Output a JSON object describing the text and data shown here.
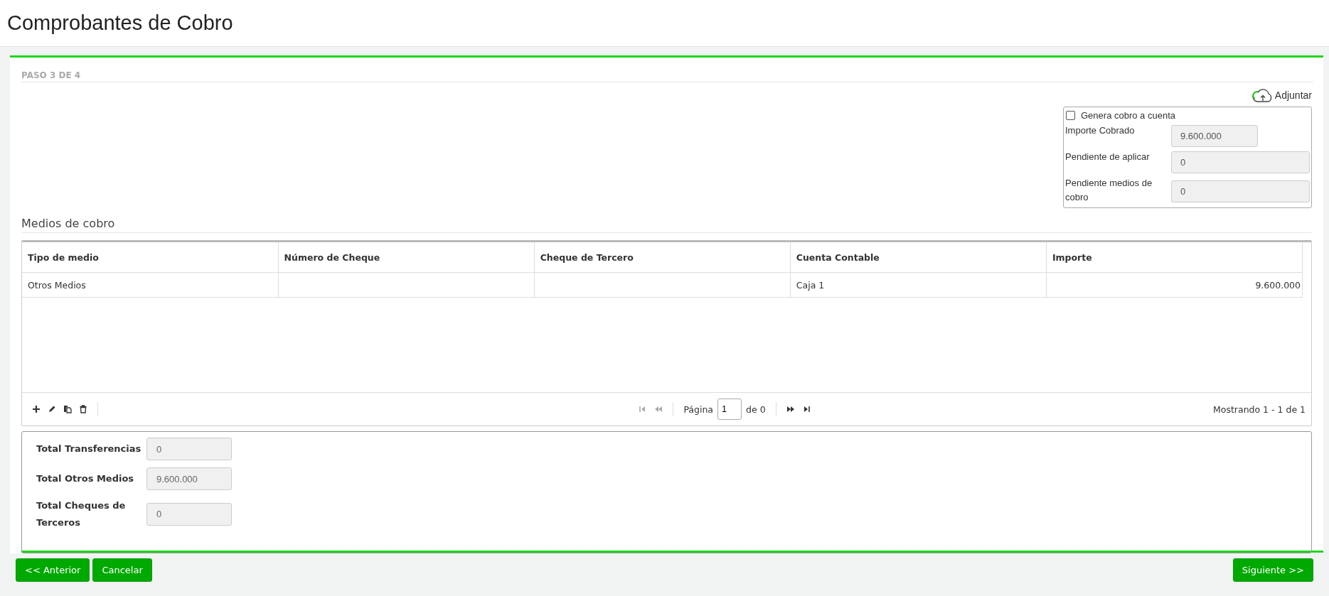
{
  "page_title": "Comprobantes de Cobro",
  "step": "PASO 3 DE 4",
  "attach": {
    "label": "Adjuntar"
  },
  "summary": {
    "checkbox": {
      "label": "Genera cobro a cuenta",
      "checked": false
    },
    "fields": [
      {
        "label": "Importe Cobrado",
        "value": "9.600.000"
      },
      {
        "label": "Pendiente de aplicar",
        "value": "0"
      },
      {
        "label": "Pendiente medios de cobro",
        "value": "0"
      }
    ]
  },
  "section_title": "Medios de cobro",
  "table": {
    "columns": [
      {
        "label": "Tipo de medio"
      },
      {
        "label": "Número de Cheque"
      },
      {
        "label": "Cheque de Tercero"
      },
      {
        "label": "Cuenta Contable"
      },
      {
        "label": "Importe"
      }
    ],
    "rows": [
      {
        "cells": [
          "Otros Medios",
          null,
          null,
          "Caja 1",
          "9.600.000"
        ]
      }
    ]
  },
  "pager": {
    "page_label": "Página",
    "page": "1",
    "total": "de 0",
    "info": "Mostrando 1 - 1 de 1"
  },
  "totals": [
    {
      "label": "Total Transferencias",
      "value": "0"
    },
    {
      "label": "Total Otros Medios",
      "value": "9.600.000"
    },
    {
      "label": "Total Cheques de Terceros",
      "value": "0"
    }
  ],
  "buttons_left": [
    "<< Anterior",
    "Cancelar"
  ],
  "buttons_right": [
    "Siguiente >>"
  ]
}
